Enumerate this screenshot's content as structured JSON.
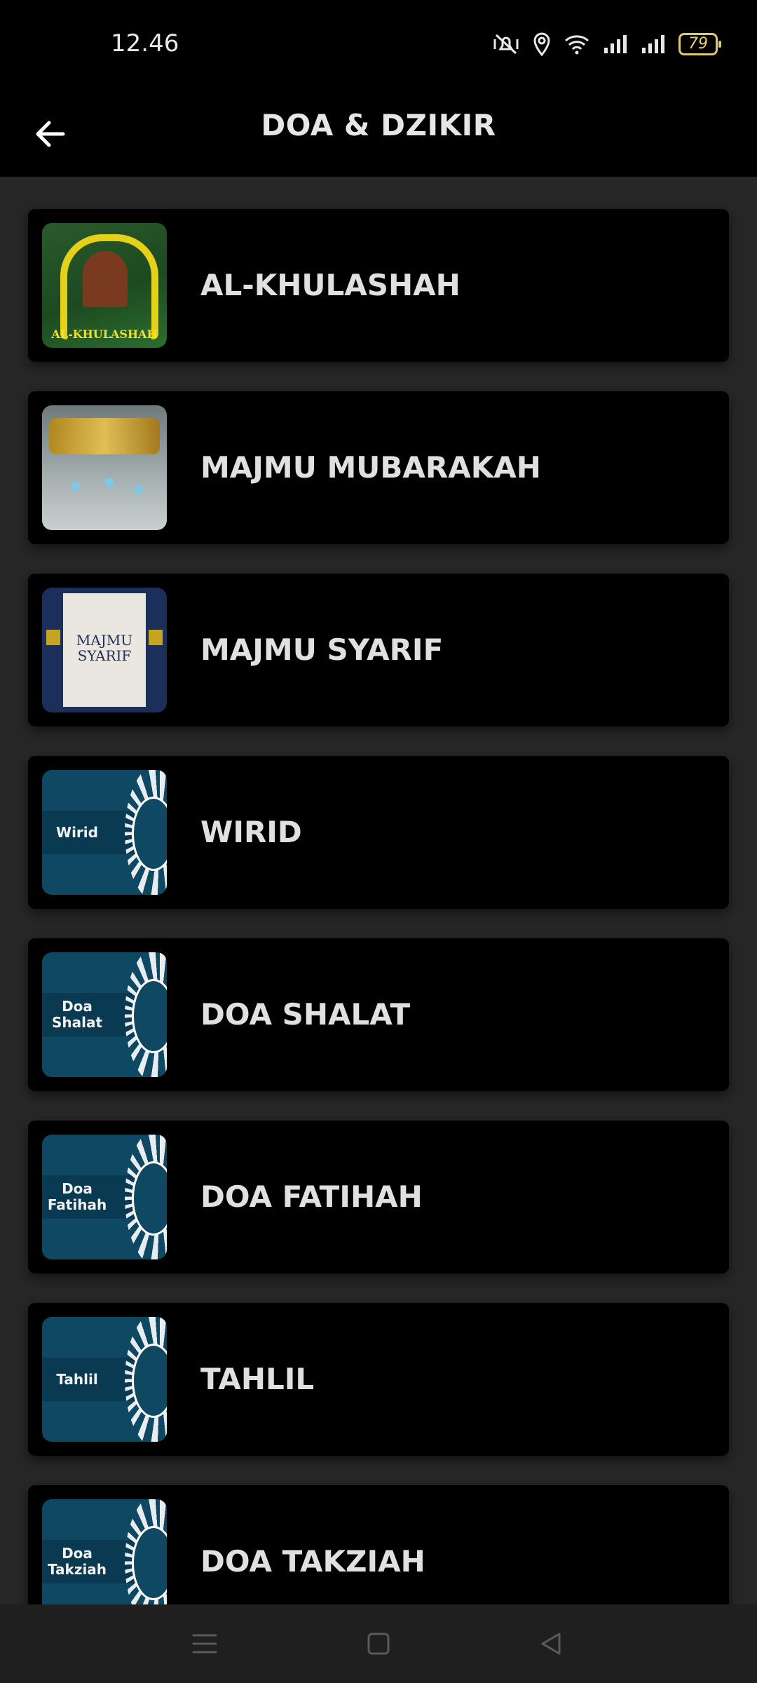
{
  "status_bar": {
    "time": "12.46",
    "battery": "79",
    "icons": [
      "mute-vibrate-icon",
      "location-icon",
      "wifi-icon",
      "signal-icon",
      "signal-icon"
    ]
  },
  "app_bar": {
    "title": "DOA & DZIKIR",
    "back_icon": "arrow-left-icon"
  },
  "items": [
    {
      "label": "AL-KHULASHAH",
      "thumb_text": "AL-KHULASHAH"
    },
    {
      "label": "MAJMU MUBARAKAH"
    },
    {
      "label": "MAJMU SYARIF",
      "thumb_text": "MAJMU SYARIF"
    },
    {
      "label": "WIRID",
      "thumb_text": "Wirid"
    },
    {
      "label": "DOA SHALAT",
      "thumb_text": "Doa Shalat"
    },
    {
      "label": "DOA FATIHAH",
      "thumb_text": "Doa Fatihah"
    },
    {
      "label": "TAHLIL",
      "thumb_text": "Tahlil"
    },
    {
      "label": "DOA TAKZIAH",
      "thumb_text": "Doa Takziah"
    }
  ],
  "nav_bar": {
    "icons": [
      "menu-icon",
      "home-icon",
      "back-triangle-icon"
    ]
  },
  "colors": {
    "background": "#272727",
    "card": "#000000",
    "teal_thumb": "#0f4863"
  }
}
